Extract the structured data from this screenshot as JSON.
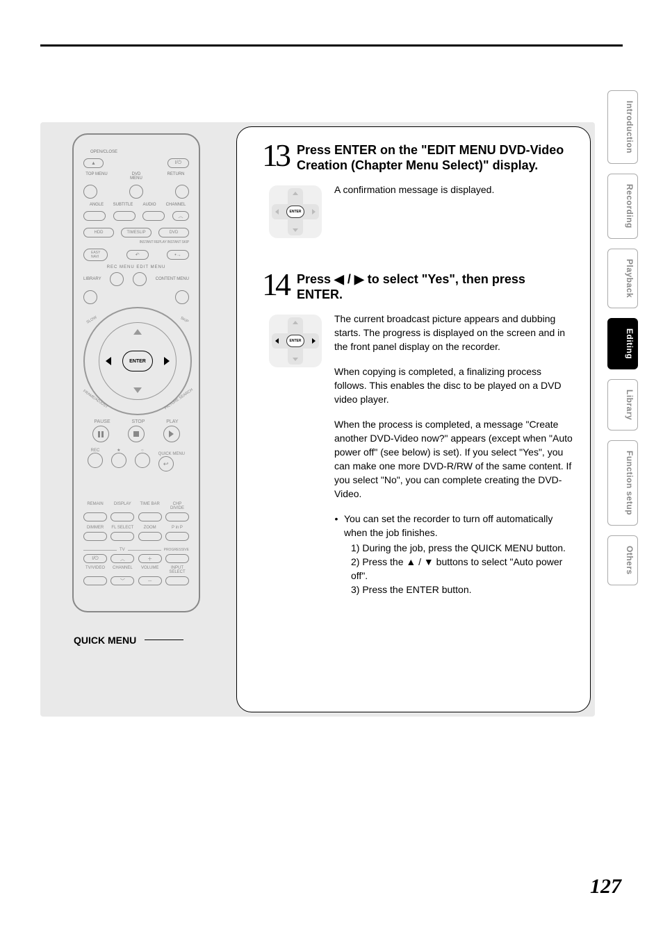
{
  "tabs": {
    "t0": "Introduction",
    "t1": "Recording",
    "t2": "Playback",
    "t3": "Editing",
    "t4": "Library",
    "t5": "Function setup",
    "t6": "Others"
  },
  "remote": {
    "open_close": "OPEN/CLOSE",
    "eject_sym": "▲",
    "power_sym": "I/⏻",
    "row1": {
      "l0": "TOP MENU",
      "l1": "DVD\nMENU",
      "l2": "RETURN"
    },
    "row2": {
      "l0": "ANGLE",
      "l1": "SUBTITLE",
      "l2": "AUDIO",
      "l3": "CHANNEL"
    },
    "mode": {
      "hdd": "HDD",
      "timeslip": "TIMESLIP",
      "dvd": "DVD"
    },
    "instant": "INSTANT REPLAY  INSTANT SKIP",
    "easy": "EASY\nNAVI",
    "menubar": "REC MENU  EDIT MENU",
    "library": "LIBRARY",
    "content": "CONTENT MENU",
    "slow": "SLOW",
    "skip": "SKIP",
    "frame": "FRAME/ADJUST",
    "picture": "PICTURE SEARCH",
    "enter": "ENTER",
    "pause_l": "PAUSE",
    "stop_l": "STOP",
    "play_l": "PLAY",
    "rec_l": "REC",
    "star_l": "★",
    "o_l": "○",
    "quick_l": "QUICK MENU",
    "mid_row1": {
      "a": "REMAIN",
      "b": "DISPLAY",
      "c": "TIME BAR",
      "d": "CHP DIVIDE"
    },
    "mid_row2": {
      "a": "DIMMER",
      "b": "FL SELECT",
      "c": "ZOOM",
      "d": "P in P"
    },
    "tv": "TV",
    "prog": "PROGRESSIVE",
    "tv_row": {
      "a": "I/⏻",
      "b": "︿",
      "c": "＋"
    },
    "bot_lbls": {
      "a": "TV/VIDEO",
      "b": "CHANNEL",
      "c": "VOLUME",
      "d": "INPUT SELECT"
    }
  },
  "callout": "QUICK MENU",
  "step13": {
    "num": "13",
    "title": "Press ENTER on the \"EDIT MENU DVD-Video Creation (Chapter Menu Select)\" display.",
    "msg": "A confirmation message is displayed.",
    "mini_enter": "ENTER"
  },
  "step14": {
    "num": "14",
    "title_pre": "Press ",
    "title_post": " to select \"Yes\", then press ENTER.",
    "arrows": "◀ / ▶",
    "mini_enter": "ENTER",
    "p1": "The current broadcast picture appears and dubbing starts. The progress is displayed on the screen and in the front panel display on the recorder.",
    "p2": "When copying is completed, a finalizing process follows. This enables the disc to be played on a DVD video player.",
    "p3": "When the process is completed, a message \"Create another DVD-Video now?\" appears (except when \"Auto power off\" (see below) is set). If you select \"Yes\", you can make one more DVD-R/RW of the same content. If you select \"No\", you can complete creating the DVD-Video.",
    "bullet": "You can set the recorder to turn off automatically when the job finishes.",
    "n1": "1)  During the job, press the QUICK MENU button.",
    "n2_pre": "2)  Press the ",
    "n2_arrows": "▲ / ▼",
    "n2_post": " buttons to select \"Auto power off\".",
    "n3": "3)  Press the ENTER button."
  },
  "page_number": "127"
}
